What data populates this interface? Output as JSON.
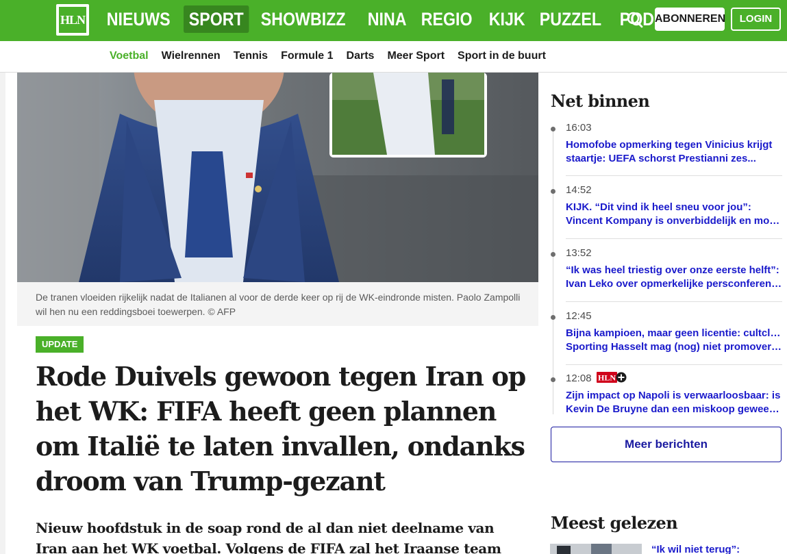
{
  "brand": {
    "logo_text": "HLN",
    "accent": "#4ab029",
    "accent_dark": "#37861f",
    "link_color": "#1a1acb"
  },
  "main_nav": [
    {
      "label": "NIEUWS",
      "active": false
    },
    {
      "label": "SPORT",
      "active": true
    },
    {
      "label": "SHOWBIZZ",
      "active": false
    },
    {
      "label": "NINA",
      "active": false
    },
    {
      "label": "REGIO",
      "active": false
    },
    {
      "label": "KIJK",
      "active": false
    },
    {
      "label": "PUZZEL",
      "active": false
    },
    {
      "label": "PODCAST",
      "active": false
    }
  ],
  "header": {
    "search_icon": "search-icon",
    "subscribe_label": "ABONNEREN",
    "login_label": "LOGIN"
  },
  "sub_nav": [
    {
      "label": "Voetbal",
      "active": true
    },
    {
      "label": "Wielrennen",
      "active": false
    },
    {
      "label": "Tennis",
      "active": false
    },
    {
      "label": "Formule 1",
      "active": false
    },
    {
      "label": "Darts",
      "active": false
    },
    {
      "label": "Meer Sport",
      "active": false
    },
    {
      "label": "Sport in de buurt",
      "active": false
    }
  ],
  "article": {
    "caption": "De tranen vloeiden rijkelijk nadat de Italianen al voor de derde keer op rij de WK-eindronde misten. Paolo Zampolli wil hen nu een reddingsboei toewerpen. © AFP",
    "badge": "UPDATE",
    "headline": "Rode Duivels gewoon tegen Iran op het WK: FIFA heeft geen plannen om Italië te laten invallen, ondanks droom van Trump-gezant",
    "lead": "Nieuw hoofdstuk in de soap rond de al dan niet deelname van Iran aan het WK voetbal. Volgens de FIFA zal het Iraanse team gewoon"
  },
  "net_binnen": {
    "title": "Net binnen",
    "items": [
      {
        "time": "16:03",
        "line1": "Homofobe opmerking tegen Vinicius krijgt",
        "line2": "staartje: UEFA schorst Prestianni zes...",
        "premium": false
      },
      {
        "time": "14:52",
        "line1": "KIJK. “Dit vind ik heel sneu voor jou”:",
        "line2": "Vincent Kompany is onverbiddelijk en moe...",
        "premium": false
      },
      {
        "time": "13:52",
        "line1": "“Ik was heel triestig over onze eerste helft”:",
        "line2": "Ivan Leko over opmerkelijke persconferent...",
        "premium": false
      },
      {
        "time": "12:45",
        "line1": "Bijna kampioen, maar geen licentie: cultclub",
        "line2": "Sporting Hasselt mag (nog) niet promovere...",
        "premium": false
      },
      {
        "time": "12:08",
        "line1": "Zijn impact op Napoli is verwaarloosbaar: is",
        "line2": "Kevin De Bruyne dan een miskoop geweest?",
        "premium": true,
        "premium_label": "HLN"
      }
    ],
    "more_label": "Meer berichten"
  },
  "meest_gelezen": {
    "title": "Meest gelezen",
    "first_link": "“Ik wil niet terug”:"
  }
}
